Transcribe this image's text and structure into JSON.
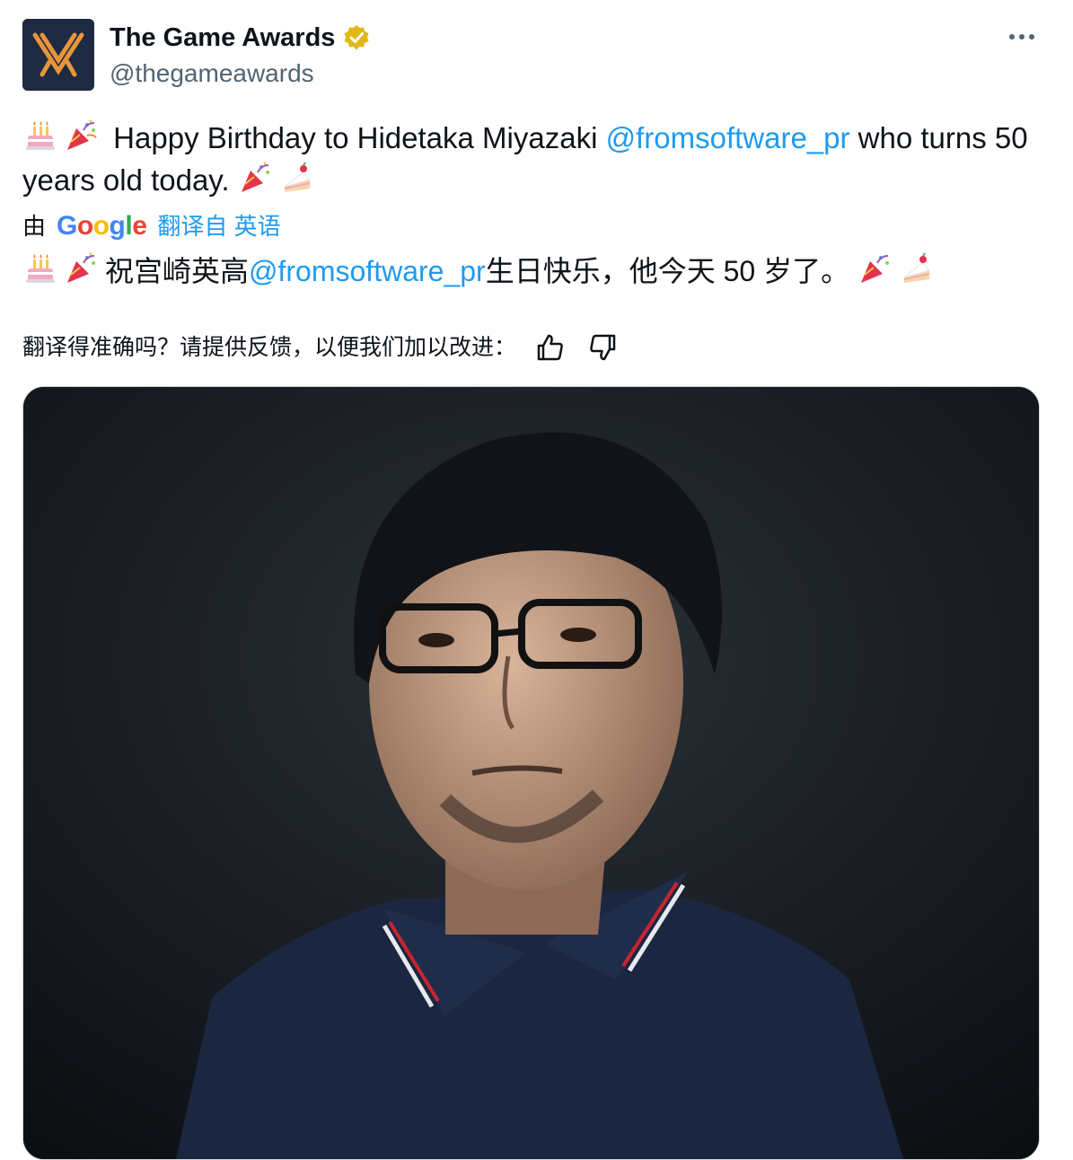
{
  "author": {
    "display_name": "The Game Awards",
    "handle": "@thegameawards",
    "verified": true,
    "avatar_icon": "game-awards-logo-icon"
  },
  "menu": {
    "more_icon": "more-icon"
  },
  "tweet": {
    "text_part1": "Happy Birthday to Hidetaka Miyazaki ",
    "mention": "@fromsoftware_pr",
    "text_part2": " who turns 50 years old today.",
    "emojis": [
      "birthday-cake-emoji",
      "party-popper-emoji",
      "party-popper-emoji",
      "shortcake-emoji"
    ]
  },
  "translation": {
    "by_label": "由",
    "provider": "Google",
    "from_label": "翻译自 英语",
    "text_part1": "祝宫崎英高",
    "mention": "@fromsoftware_pr",
    "text_part2": "生日快乐，他今天 50 岁了。"
  },
  "feedback": {
    "label": "翻译得准确吗？请提供反馈，以便我们加以改进：",
    "thumbs_up_icon": "thumbs-up-icon",
    "thumbs_down_icon": "thumbs-down-icon"
  },
  "colors": {
    "link": "#1d9bf0",
    "text": "#0f1419",
    "secondary": "#536471",
    "verified_gold": "#e2b719"
  }
}
